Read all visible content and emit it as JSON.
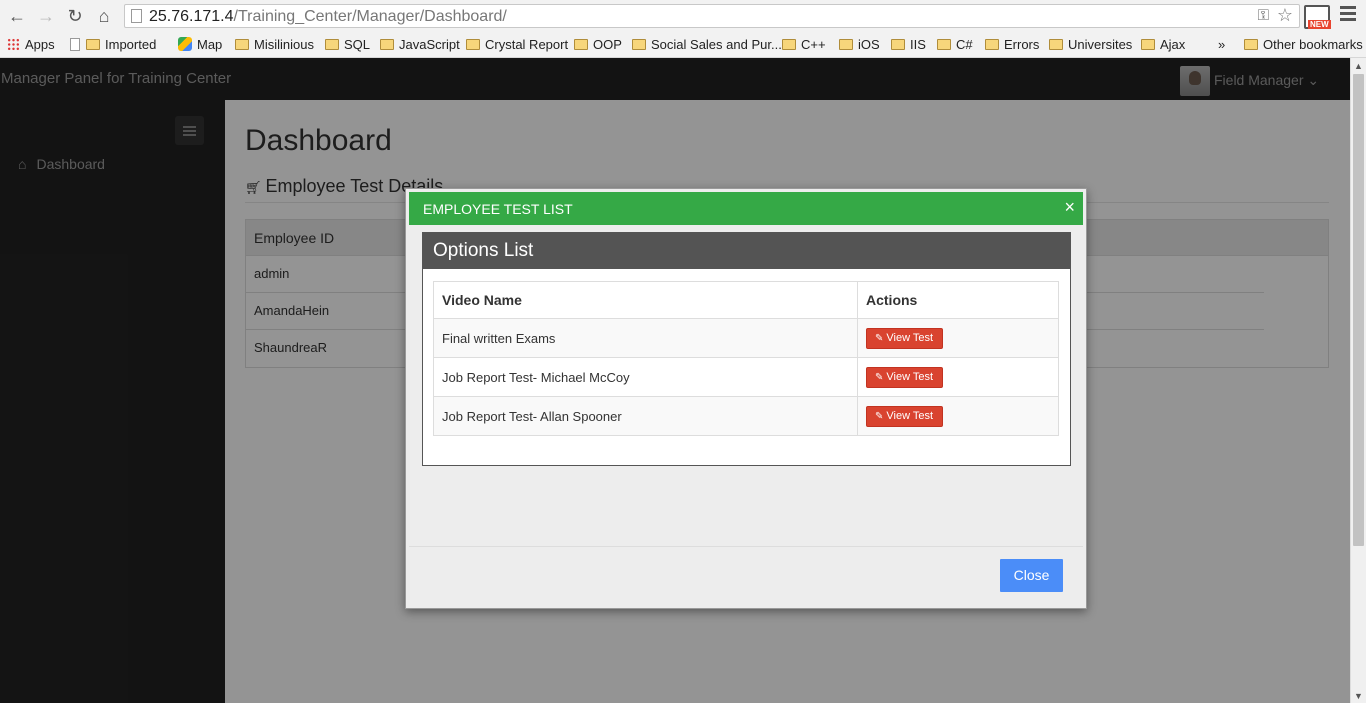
{
  "browser": {
    "url_host": "25.76.171.4",
    "url_path": "/Training_Center/Manager/Dashboard/",
    "bookmarks": {
      "apps": "Apps",
      "imported": "Imported",
      "map": "Map",
      "misilinious": "Misilinious",
      "sql": "SQL",
      "javascript": "JavaScript",
      "crystal_report": "Crystal Report",
      "oop": "OOP",
      "social_sales": "Social Sales and Pur...",
      "cpp": "C++",
      "ios": "iOS",
      "iis": "IIS",
      "csharp": "C#",
      "errors": "Errors",
      "universites": "Universites",
      "ajax": "Ajax",
      "more": "»",
      "other": "Other bookmarks"
    },
    "new_badge": "NEW"
  },
  "header": {
    "brand": "Manager Panel for Training Center",
    "user_name": "Field Manager",
    "caret": "⌄"
  },
  "sidebar": {
    "items": [
      {
        "label": "Dashboard"
      }
    ]
  },
  "main": {
    "title": "Dashboard",
    "section_title": "Employee Test Details",
    "table": {
      "header": "Employee ID",
      "rows": [
        "admin",
        "AmandaHein",
        "ShaundreaR"
      ]
    }
  },
  "modal": {
    "title": "EMPLOYEE TEST LIST",
    "close_x": "×",
    "panel_title": "Options List",
    "columns": [
      "Video Name",
      "Actions"
    ],
    "rows": [
      {
        "name": "Final written Exams",
        "action": "View Test"
      },
      {
        "name": "Job Report Test- Michael McCoy",
        "action": "View Test"
      },
      {
        "name": "Job Report Test- Allan Spooner",
        "action": "View Test"
      }
    ],
    "close_label": "Close"
  },
  "colors": {
    "modal_header": "#35a946",
    "panel_header": "#545454",
    "view_button": "#d9432f",
    "close_button": "#4b8df8",
    "navbar": "#222222"
  },
  "icons": {
    "back": "back-arrow-icon",
    "forward": "forward-arrow-icon",
    "reload": "reload-icon",
    "home": "home-icon",
    "star": "bookmark-star-icon",
    "menu": "menu-icon",
    "sidebar_toggle": "hamburger-icon",
    "cart": "cart-icon",
    "edit": "edit-icon"
  }
}
